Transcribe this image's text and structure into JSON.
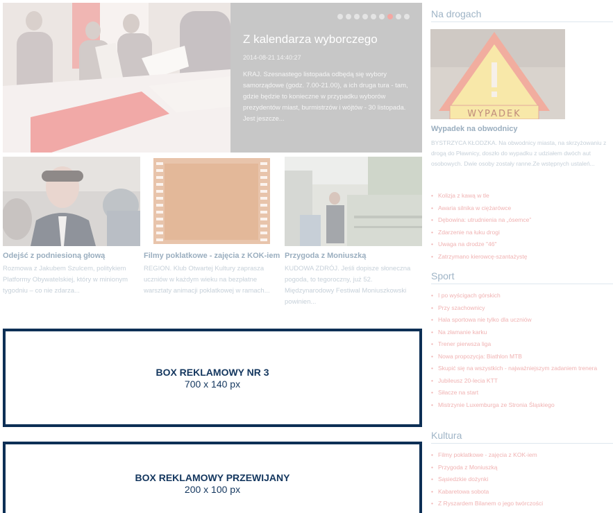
{
  "slider": {
    "title": "Z kalendarza wyborczego",
    "date": "2014-08-21 14:40:27",
    "text": "KRAJ. Szesnastego listopada odbędą się wybory samorządowe (godz. 7.00-21.00), a ich druga tura - tam, gdzie będzie to konieczne w przypadku wyborów prezydentów miast, burmistrzów i wójtów - 30 listopada. Jest jeszcze...",
    "dot_count": 9,
    "active_dot": 7,
    "colors": {
      "panel": "#c7c7c7",
      "dot": "#e4e4e4",
      "dot_active": "#f4a7a2"
    }
  },
  "teasers": [
    {
      "title": "Odejść z podniesioną głową",
      "text": "Rozmowa z Jakubem Szulcem, politykiem Platformy Obywatelskiej, który w minionym tygodniu – co nie zdarza..."
    },
    {
      "title": "Filmy poklatkowe - zajęcia z KOK-iem",
      "text": "REGION. Klub Otwartej Kultury zaprasza uczniów w każdym wieku na bezpłatne warsztaty animacji poklatkowej w ramach..."
    },
    {
      "title": "Przygoda z Moniuszką",
      "text": "KUDOWA ZDRÓJ. Jeśli dopisze słoneczna pogoda, to tegoroczny, już 52. Międzynarodowy Festiwal Moniuszkowski powinien..."
    }
  ],
  "ads": [
    {
      "title": "BOX REKLAMOWY NR 3",
      "size": "700 x 140 px"
    },
    {
      "title": "BOX REKLAMOWY PRZEWIJANY",
      "size": "200 x 100 px"
    }
  ],
  "sidebar": {
    "drogi": {
      "heading": "Na drogach",
      "image_sign": "WYPADEK",
      "feature_title": "Wypadek na obwodnicy",
      "feature_text": "BYSTRZYCA KŁODZKA. Na obwodnicy miasta, na skrzyżowaniu z drogą do Pławnicy, doszło do wypadku z udziałem dwóch aut osobowych. Dwie osoby zostały ranne.Ze wstępnych ustaleń...",
      "items": [
        "Kolizja z kawą w tle",
        "Awaria silnika w ciężarówce",
        "Dębowina: utrudnienia na „ósemce”",
        "Zdarzenie na łuku drogi",
        "Uwaga na drodze \"46\"",
        "Zatrzymano kierowcę-szantażystę"
      ]
    },
    "sport": {
      "heading": "Sport",
      "items": [
        "I po wyścigach górskich",
        "Przy szachownicy",
        "Hala sportowa nie tylko dla uczniów",
        "Na złamanie karku",
        "Trener pierwsza liga",
        "Nowa propozycja: Biathlon MTB",
        "Skupić się na wszystkich - najważniejszym zadaniem trenera",
        "Jubileusz 20-lecia KTT",
        "Siłacze na start",
        "Mistrzynie Luxemburga ze Stronia Śląskiego"
      ]
    },
    "kultura": {
      "heading": "Kultura",
      "items": [
        "Filmy poklatkowe - zajęcia z KOK-iem",
        "Przygoda z Moniuszką",
        "Sąsiedzkie dożynki",
        "Kabaretowa sobota",
        "Z Ryszardem Bilanem o jego twórczości"
      ]
    }
  }
}
